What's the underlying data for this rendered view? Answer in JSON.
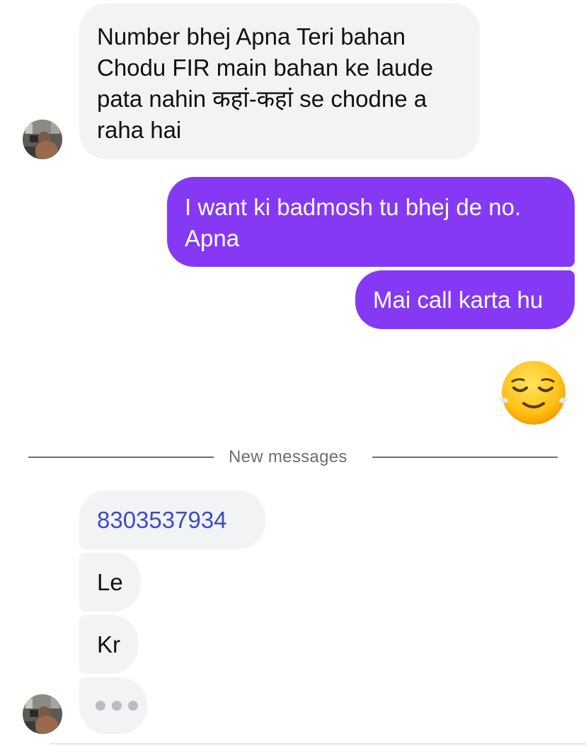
{
  "messages": {
    "msg1": "Number bhej Apna Teri bahan Chodu FIR main bahan ke laude pata nahin कहां-कहां se chodne a raha hai",
    "msg2": "I want ki badmosh tu bhej de no. Apna",
    "msg3": "Mai call karta hu",
    "msg4_emoji": "😌",
    "msg5_phone": "8303537934",
    "msg6": "Le",
    "msg7": "Kr"
  },
  "divider": {
    "label": "New messages"
  },
  "colors": {
    "outgoing_bubble": "#8539f5",
    "incoming_bubble": "#f1f3f5",
    "link": "#3e4cc4",
    "divider": "#6b6f73"
  },
  "icons": {
    "avatar": "contact-avatar-photo",
    "typing": "typing-indicator-dots",
    "emoji": "relieved-face-emoji"
  }
}
